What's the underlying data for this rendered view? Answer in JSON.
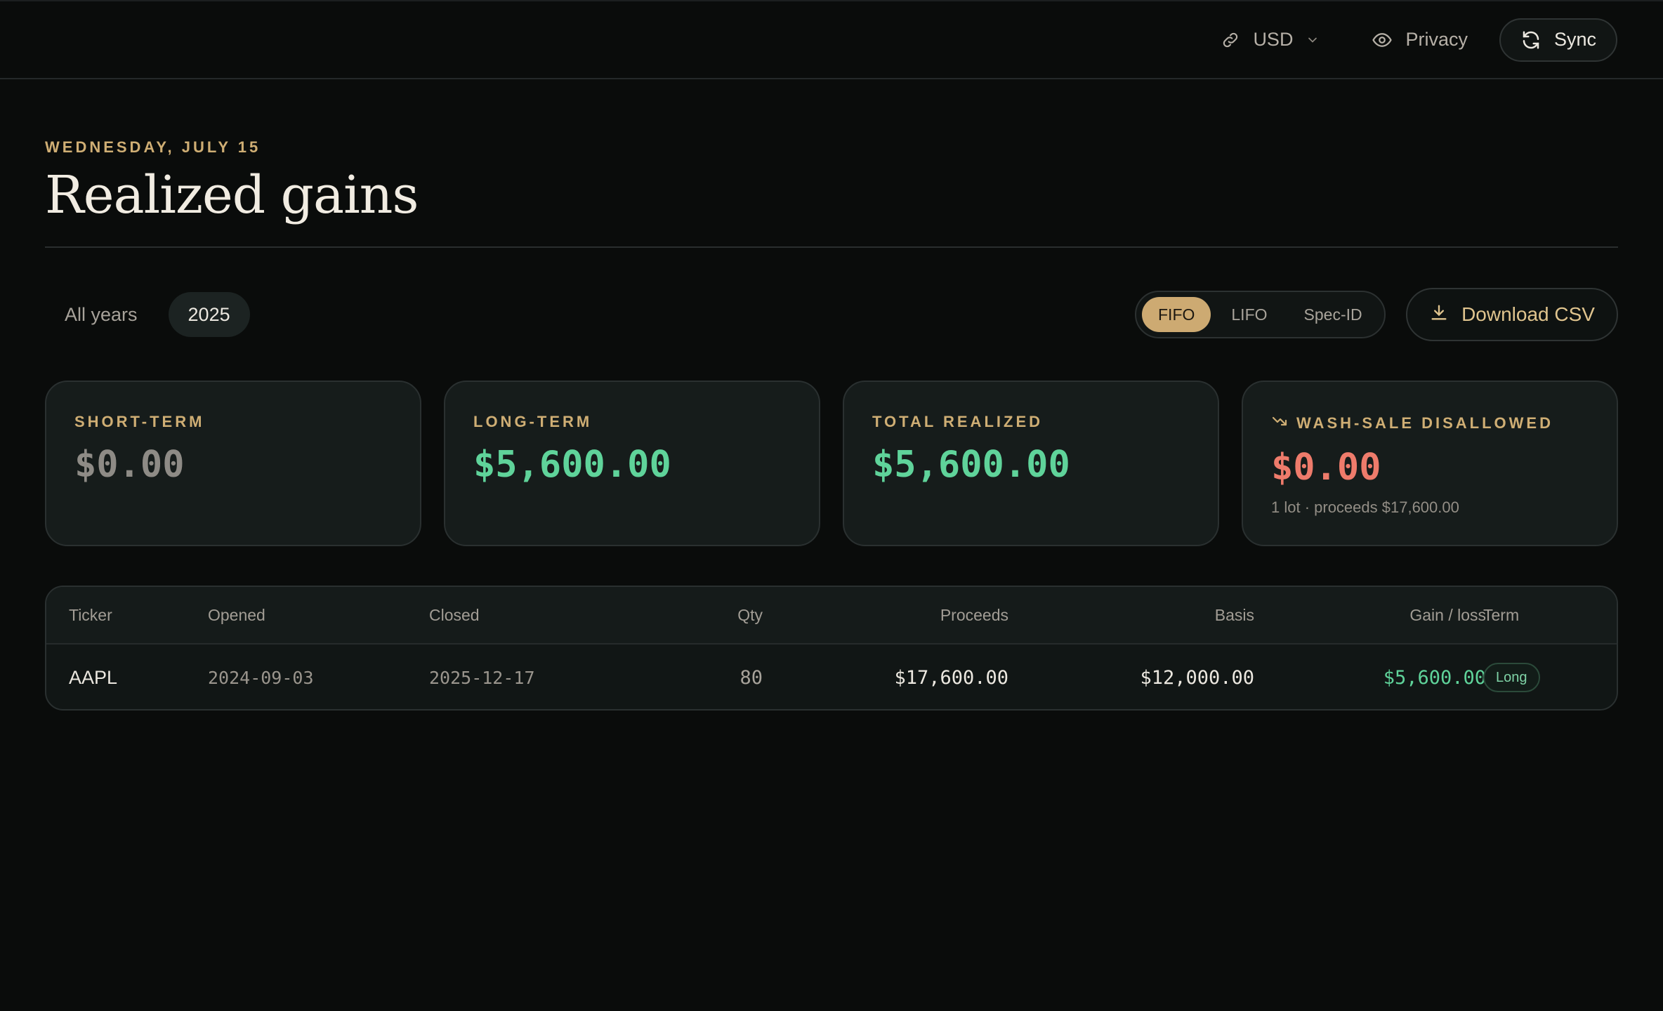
{
  "topbar": {
    "currency": "USD",
    "privacy": "Privacy",
    "sync": "Sync"
  },
  "header": {
    "date": "WEDNESDAY, JULY 15",
    "title": "Realized gains"
  },
  "filters": {
    "years": [
      "All years",
      "2025"
    ],
    "selected_year": "2025",
    "methods": [
      "FIFO",
      "LIFO",
      "Spec-ID"
    ],
    "selected_method": "FIFO",
    "download": "Download CSV"
  },
  "cards": [
    {
      "label": "SHORT-TERM",
      "value": "$0.00",
      "tone": "muted"
    },
    {
      "label": "LONG-TERM",
      "value": "$5,600.00",
      "tone": "green"
    },
    {
      "label": "TOTAL REALIZED",
      "value": "$5,600.00",
      "tone": "green"
    },
    {
      "label": "WASH-SALE DISALLOWED",
      "value": "$0.00",
      "tone": "red",
      "sub": "1 lot · proceeds $17,600.00"
    }
  ],
  "table": {
    "columns": [
      "Ticker",
      "Opened",
      "Closed",
      "Qty",
      "Proceeds",
      "Basis",
      "Gain / loss",
      "Term"
    ],
    "rows": [
      {
        "ticker": "AAPL",
        "opened": "2024-09-03",
        "closed": "2025-12-17",
        "qty": "80",
        "proceeds": "$17,600.00",
        "basis": "$12,000.00",
        "gain": "$5,600.00",
        "term": "Long"
      }
    ]
  },
  "colors": {
    "accent": "#cfae74",
    "positive": "#5fd39a",
    "negative": "#ee7b6b",
    "background": "#0a0c0b"
  }
}
